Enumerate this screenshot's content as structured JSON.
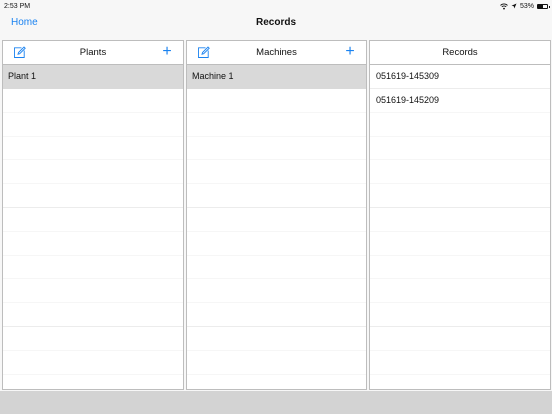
{
  "status": {
    "time": "2:53 PM",
    "battery_text": "53%",
    "battery_level": 0.53
  },
  "nav": {
    "back_label": "Home",
    "title": "Records"
  },
  "columns": {
    "plants": {
      "title": "Plants",
      "items": [
        {
          "label": "Plant 1",
          "selected": true
        }
      ]
    },
    "machines": {
      "title": "Machines",
      "items": [
        {
          "label": "Machine 1",
          "selected": true
        }
      ]
    },
    "records": {
      "title": "Records",
      "items": [
        {
          "label": "051619-145309",
          "selected": false
        },
        {
          "label": "051619-145209",
          "selected": false
        }
      ]
    }
  },
  "colors": {
    "accent": "#1a82f0",
    "selected_row": "#d9d9d9",
    "border": "#bdbdbd",
    "footer": "#d3d3d3"
  }
}
